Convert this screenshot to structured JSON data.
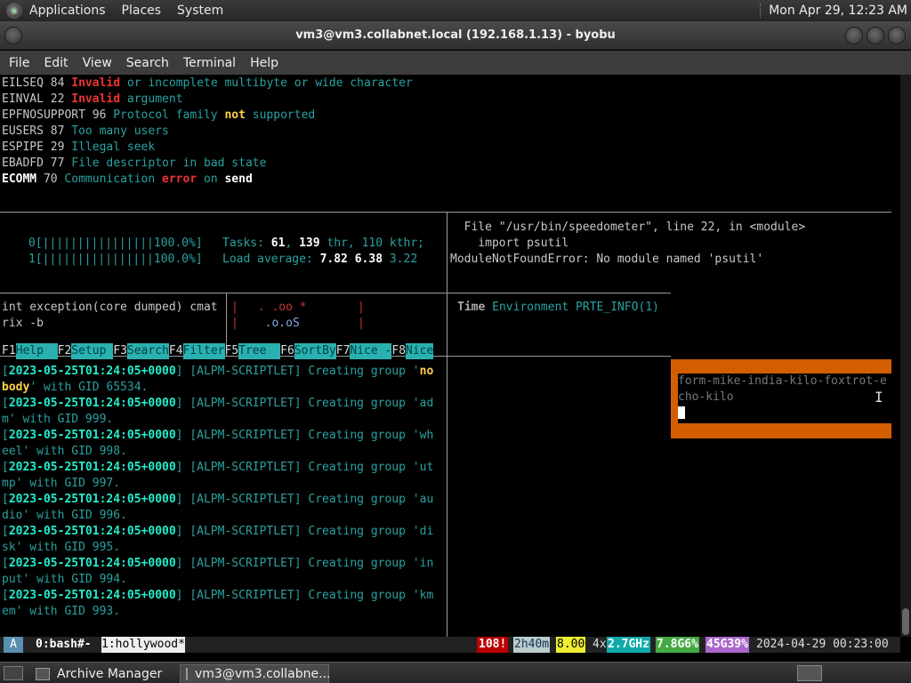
{
  "system_panel": {
    "menus": [
      "Applications",
      "Places",
      "System"
    ],
    "clock": "Mon Apr 29, 12:23 AM"
  },
  "window": {
    "title": "vm3@vm3.collabnet.local (192.168.1.13) - byobu"
  },
  "menubar": [
    "File",
    "Edit",
    "View",
    "Search",
    "Terminal",
    "Help"
  ],
  "errno_lines": [
    {
      "code": "EILSEQ",
      "num": "84",
      "w1": "Invalid",
      "rest": "or incomplete multibyte or wide character"
    },
    {
      "code": "EINVAL",
      "num": "22",
      "w1": "Invalid",
      "rest": "argument"
    },
    {
      "code": "EPFNOSUPPORT",
      "num": "96",
      "a": "Protocol family",
      "w1": "not",
      "rest": "supported"
    },
    {
      "code": "EUSERS",
      "num": "87",
      "rest": "Too many users"
    },
    {
      "code": "ESPIPE",
      "num": "29",
      "rest": "Illegal seek"
    },
    {
      "code": "EBADFD",
      "num": "77",
      "rest": "File descriptor in bad state"
    },
    {
      "code": "ECOMM",
      "num": "70",
      "a": "Communication",
      "w1": "error",
      "b": "on",
      "w2": "send"
    }
  ],
  "htop": {
    "cpu0": "0[||||||||||||||||100.0%]",
    "cpu1": "1[||||||||||||||||100.0%]",
    "tasks_label": "Tasks:",
    "tasks": "61",
    "thr": "139",
    "thr_label": "thr,",
    "kthr": "110 kthr;",
    "load_label": "Load average:",
    "load1": "7.82",
    "load5": "6.38",
    "load15": "3.22",
    "fkeys": [
      {
        "k": "F1",
        "l": "Help  "
      },
      {
        "k": "F2",
        "l": "Setup "
      },
      {
        "k": "F3",
        "l": "Search"
      },
      {
        "k": "F4",
        "l": "Filter"
      },
      {
        "k": "F5",
        "l": "Tree  "
      },
      {
        "k": "F6",
        "l": "SortBy"
      },
      {
        "k": "F7",
        "l": "Nice -"
      },
      {
        "k": "F8",
        "l": "Nice"
      }
    ]
  },
  "python_error": {
    "line1": "  File \"/usr/bin/speedometer\", line 22, in <module>",
    "line2": "    import psutil",
    "line3": "ModuleNotFoundError: No module named 'psutil'"
  },
  "mid_left": {
    "line1": "int exception(core dumped) cmat",
    "line2": "rix -b"
  },
  "mid_ascii": {
    "line1": " . .oo *",
    "line2": "  .o.oS"
  },
  "mid_right": {
    "label": "Time",
    "rest": "Environment PRTE_INFO(1)"
  },
  "orange_box": {
    "line1": "form-mike-india-kilo-foxtrot-e",
    "line2": "cho-kilo"
  },
  "log_lines": [
    {
      "ts": "2023-05-25T01:24:05+0000",
      "tag": "[ALPM-SCRIPTLET]",
      "msg": "Creating group '",
      "g1": "no",
      "g2": "body",
      "tail": "' with GID 65534."
    },
    {
      "ts": "2023-05-25T01:24:05+0000",
      "tag": "[ALPM-SCRIPTLET]",
      "msg": "Creating group '",
      "g1": "ad",
      "g2": "m",
      "tail": "' with GID 999."
    },
    {
      "ts": "2023-05-25T01:24:05+0000",
      "tag": "[ALPM-SCRIPTLET]",
      "msg": "Creating group '",
      "g1": "wh",
      "g2": "eel",
      "tail": "' with GID 998."
    },
    {
      "ts": "2023-05-25T01:24:05+0000",
      "tag": "[ALPM-SCRIPTLET]",
      "msg": "Creating group '",
      "g1": "ut",
      "g2": "mp",
      "tail": "' with GID 997."
    },
    {
      "ts": "2023-05-25T01:24:05+0000",
      "tag": "[ALPM-SCRIPTLET]",
      "msg": "Creating group '",
      "g1": "au",
      "g2": "dio",
      "tail": "' with GID 996."
    },
    {
      "ts": "2023-05-25T01:24:05+0000",
      "tag": "[ALPM-SCRIPTLET]",
      "msg": "Creating group '",
      "g1": "di",
      "g2": "sk",
      "tail": "' with GID 995."
    },
    {
      "ts": "2023-05-25T01:24:05+0000",
      "tag": "[ALPM-SCRIPTLET]",
      "msg": "Creating group '",
      "g1": "in",
      "g2": "put",
      "tail": "' with GID 994."
    },
    {
      "ts": "2023-05-25T01:24:05+0000",
      "tag": "[ALPM-SCRIPTLET]",
      "msg": "Creating group '",
      "g1": "km",
      "g2": "em",
      "tail": "' with GID 993."
    }
  ],
  "status_bar": {
    "logo": "A",
    "win0": "0:bash#-",
    "win1": "1:hollywood*",
    "updates": "108!",
    "uptime": "2h40m",
    "load": "8.00",
    "cpu": "4x",
    "freq": "2.7GHz",
    "mem": "7.8G6%",
    "disk": "45G39%",
    "datetime": "2024-04-29 00:23:00"
  },
  "taskbar": [
    {
      "label": "Archive Manager"
    },
    {
      "label": "vm3@vm3.collabne..."
    }
  ],
  "colors": {
    "teal": "#2aa1a1",
    "red": "#ee3333",
    "orange": "#d35e00",
    "yellow": "#ffd24a"
  }
}
